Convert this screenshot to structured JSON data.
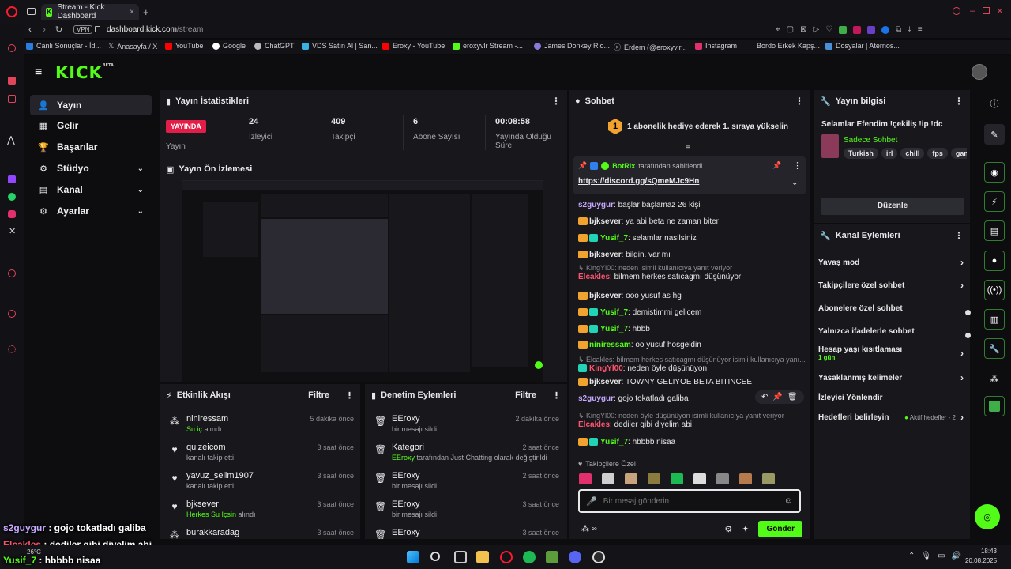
{
  "browser": {
    "tab_title": "Stream - Kick Dashboard",
    "vpn": "VPN",
    "url_domain": "dashboard.kick.com",
    "url_path": "/stream",
    "bookmarks": [
      "Canlı Sonuçlar - İd...",
      "Anasayfa / X",
      "YouTube",
      "Google",
      "ChatGPT",
      "VDS Satın Al | San...",
      "Eroxy - YouTube",
      "eroxyvlr Stream -...",
      "James Donkey Rio...",
      "Erdem (@eroxyvlr...",
      "Instagram",
      "Bordo Erkek Kapş...",
      "Dosyalar | Aternos..."
    ]
  },
  "brand": {
    "logo": "KICK",
    "beta": "BETA",
    "accent": "#53fc18"
  },
  "sidebar": {
    "items": [
      {
        "label": "Yayın"
      },
      {
        "label": "Gelir"
      },
      {
        "label": "Başarılar"
      },
      {
        "label": "Stüdyo"
      },
      {
        "label": "Kanal"
      },
      {
        "label": "Ayarlar"
      }
    ]
  },
  "stats": {
    "title": "Yayın İstatistikleri",
    "live_label": "YAYINDA",
    "stream_label": "Yayın",
    "viewers": {
      "value": "24",
      "label": "İzleyici"
    },
    "followers": {
      "value": "409",
      "label": "Takipçi"
    },
    "subs": {
      "value": "6",
      "label": "Abone Sayısı"
    },
    "uptime": {
      "value": "00:08:58",
      "label": "Yayında Olduğu Süre"
    }
  },
  "preview": {
    "title": "Yayın Ön İzlemesi"
  },
  "activity": {
    "title": "Etkinlik Akışı",
    "filter": "Filtre",
    "events": [
      {
        "name": "niniressam",
        "sub_pre": "",
        "sub_hl": "Su iç",
        "sub_post": " alındı",
        "time": "5 dakika önce"
      },
      {
        "name": "quizeicom",
        "sub_pre": "kanalı takip etti",
        "sub_hl": "",
        "sub_post": "",
        "time": "3 saat önce"
      },
      {
        "name": "yavuz_selim1907",
        "sub_pre": "kanalı takip etti",
        "sub_hl": "",
        "sub_post": "",
        "time": "3 saat önce"
      },
      {
        "name": "bjksever",
        "sub_pre": "",
        "sub_hl": "Herkes Su İçsin",
        "sub_post": " alındı",
        "time": "3 saat önce"
      },
      {
        "name": "burakkaradag",
        "sub_pre": "",
        "sub_hl": "",
        "sub_post": "",
        "time": "3 saat önce"
      }
    ]
  },
  "moderation": {
    "title": "Denetim Eylemleri",
    "filter": "Filtre",
    "events": [
      {
        "name": "EEroxy",
        "sub_pre": "bir mesajı sildi",
        "sub_hl": "",
        "sub_post": "",
        "time": "2 dakika önce"
      },
      {
        "name": "Kategori",
        "sub_pre": "",
        "sub_hl": "EEroxy",
        "sub_post": " tarafından Just Chatting olarak değiştirildi",
        "time": "2 saat önce"
      },
      {
        "name": "EEroxy",
        "sub_pre": "bir mesajı sildi",
        "sub_hl": "",
        "sub_post": "",
        "time": "2 saat önce"
      },
      {
        "name": "EEroxy",
        "sub_pre": "bir mesajı sildi",
        "sub_hl": "",
        "sub_post": "",
        "time": "3 saat önce"
      },
      {
        "name": "EEroxy",
        "sub_pre": "",
        "sub_hl": "",
        "sub_post": "",
        "time": "3 saat önce"
      }
    ]
  },
  "chat": {
    "title": "Sohbet",
    "gift_banner": "1 abonelik hediye ederek 1. sıraya yükselin",
    "pinned_by": "BotRix",
    "pinned_by_suffix": " tarafından sabitlendi",
    "pinned_link": "https://discord.gg/sQmeMJc9Hn",
    "messages": [
      {
        "user": "s2guygur",
        "color": "#c7a9ff",
        "text": "başlar başlamaz 26 kişi",
        "badges": ""
      },
      {
        "user": "bjksever",
        "color": "#e8e8ea",
        "text": "ya abi beta ne zaman biter",
        "badges": "c"
      },
      {
        "user": "Yusif_7",
        "color": "#53fc18",
        "text": "selamlar nasilsiniz",
        "badges": "cs"
      },
      {
        "user": "bjksever",
        "color": "#e8e8ea",
        "text": "bilgin. var mı",
        "badges": "c"
      },
      {
        "user": "Elcakles",
        "color": "#ff5470",
        "text": "bilmem herkes satıcagmı düşünüyor",
        "badges": "",
        "reply": "KingYl00: neden isimli kullanıcıya yanıt veriyor"
      },
      {
        "user": "bjksever",
        "color": "#e8e8ea",
        "text": "ooo yusuf as hg",
        "badges": "c"
      },
      {
        "user": "Yusif_7",
        "color": "#53fc18",
        "text": "demistimmi gelicem",
        "badges": "cs"
      },
      {
        "user": "Yusif_7",
        "color": "#53fc18",
        "text": "hbbb",
        "badges": "cs"
      },
      {
        "user": "niniressam",
        "color": "#53fc18",
        "text": "oo yusuf hosgeldin",
        "badges": "c"
      },
      {
        "user": "KingYl00",
        "color": "#ff5470",
        "text": "neden öyle düşünüyon",
        "badges": "s",
        "reply": "Elcakles: bilmem herkes satıcagmı düşünüyor isimli kullanıcıya yanı..."
      },
      {
        "user": "bjksever",
        "color": "#e8e8ea",
        "text": "TOWNY GELİYOE BETA BİTİNCEE",
        "badges": "c"
      },
      {
        "user": "s2guygur",
        "color": "#c7a9ff",
        "text": "gojo tokatladı galiba",
        "badges": ""
      },
      {
        "user": "Elcakles",
        "color": "#ff5470",
        "text": "dediler gibi diyelim abi",
        "badges": "",
        "reply": "KingYl00: neden öyle düşünüyon isimli kullanıcıya yanıt veriyor"
      },
      {
        "user": "Yusif_7",
        "color": "#53fc18",
        "text": "hbbbb nisaa",
        "badges": "cs"
      }
    ],
    "followers_only_label": "Takipçilere Özel",
    "input_placeholder": "Bir mesaj gönderin",
    "send": "Gönder"
  },
  "stream_info": {
    "title": "Yayın bilgisi",
    "stream_title": "Selamlar Efendim !çekiliş !ip !dc",
    "category": "Sadece Sohbet",
    "tags": [
      "Turkish",
      "irl",
      "chill",
      "fps",
      "gamir"
    ],
    "edit": "Düzenle"
  },
  "channel_actions": {
    "title": "Kanal Eylemleri",
    "items": [
      {
        "label": "Yavaş mod",
        "sub": "",
        "right": ""
      },
      {
        "label": "Takipçilere özel sohbet",
        "sub": "",
        "right": ""
      },
      {
        "label": "Abonelere özel sohbet",
        "sub": "",
        "right": ""
      },
      {
        "label": "Yalnızca ifadelerle sohbet",
        "sub": "",
        "right": ""
      },
      {
        "label": "Hesap yaşı kısıtlaması",
        "sub": "1 gün",
        "right": ""
      },
      {
        "label": "Yasaklanmış kelimeler",
        "sub": "",
        "right": ""
      },
      {
        "label": "İzleyici Yönlendir",
        "sub": "",
        "right": ""
      },
      {
        "label": "Hedefleri belirleyin",
        "sub": "",
        "right": "Aktif hedefler - 2"
      }
    ]
  },
  "overlay_chat": [
    {
      "user": "s2guygur",
      "color": "#c7a9ff",
      "text": " : gojo tokatladı galiba"
    },
    {
      "user": "Elcakles",
      "color": "#ff5470",
      "text": " : dediler gibi diyelim abi"
    },
    {
      "user": "Yusif_7",
      "color": "#53fc18",
      "text": " : hbbbb nisaa"
    }
  ],
  "taskbar": {
    "weather": "26°C",
    "time": "18:43",
    "date": "20.08.2025"
  }
}
